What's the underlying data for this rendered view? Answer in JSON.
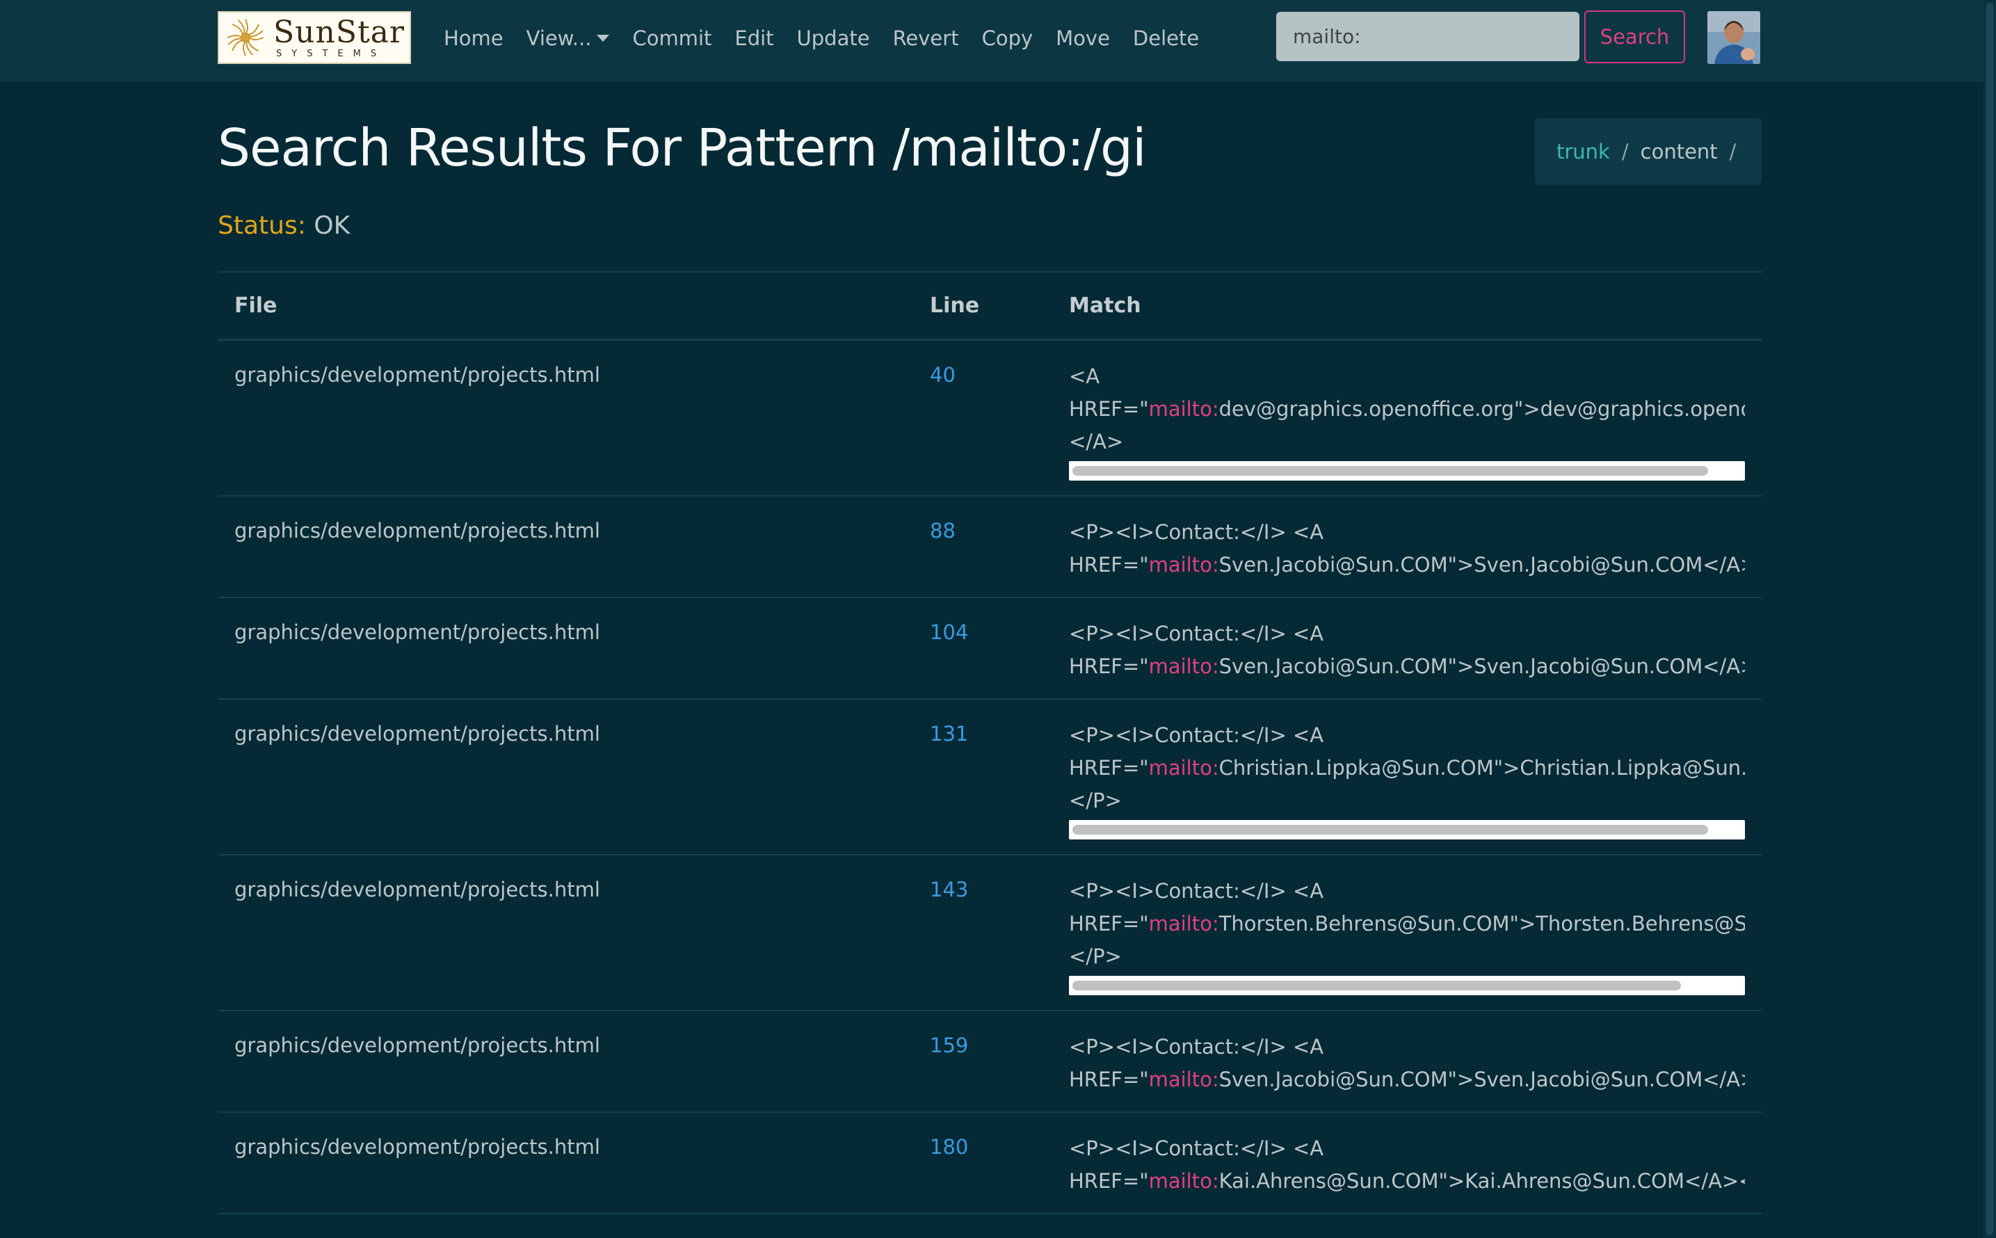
{
  "brand": {
    "name": "SunStar",
    "subtitle": "SYSTEMS"
  },
  "nav": {
    "items": [
      "Home",
      "View...",
      "Commit",
      "Edit",
      "Update",
      "Revert",
      "Copy",
      "Move",
      "Delete"
    ]
  },
  "search": {
    "value": "mailto:",
    "button_label": "Search"
  },
  "page": {
    "title": "Search Results For Pattern /mailto:/gi",
    "status_label": "Status:",
    "status_value": "OK"
  },
  "breadcrumb": {
    "items": [
      "trunk",
      "content"
    ],
    "separator": "/"
  },
  "table": {
    "headers": {
      "file": "File",
      "line": "Line",
      "match": "Match"
    },
    "rows": [
      {
        "file": "graphics/development/projects.html",
        "line": "40",
        "match_lines": [
          {
            "pre": "<A",
            "hl": "",
            "post": ""
          },
          {
            "pre": "HREF=\"",
            "hl": "mailto:",
            "post": "dev@graphics.openoffice.org\">dev@graphics.openoffice.org"
          },
          {
            "pre": "</A>",
            "hl": "",
            "post": ""
          }
        ],
        "scroll_visible_fraction": 0.95
      },
      {
        "file": "graphics/development/projects.html",
        "line": "88",
        "match_lines": [
          {
            "pre": "<P><I>Contact:</I> <A",
            "hl": "",
            "post": ""
          },
          {
            "pre": "HREF=\"",
            "hl": "mailto:",
            "post": "Sven.Jacobi@Sun.COM\">Sven.Jacobi@Sun.COM</A></P>"
          }
        ]
      },
      {
        "file": "graphics/development/projects.html",
        "line": "104",
        "match_lines": [
          {
            "pre": "<P><I>Contact:</I> <A",
            "hl": "",
            "post": ""
          },
          {
            "pre": "HREF=\"",
            "hl": "mailto:",
            "post": "Sven.Jacobi@Sun.COM\">Sven.Jacobi@Sun.COM</A></P>"
          }
        ]
      },
      {
        "file": "graphics/development/projects.html",
        "line": "131",
        "match_lines": [
          {
            "pre": "<P><I>Contact:</I> <A",
            "hl": "",
            "post": ""
          },
          {
            "pre": "HREF=\"",
            "hl": "mailto:",
            "post": "Christian.Lippka@Sun.COM\">Christian.Lippka@Sun.COM</A>"
          },
          {
            "pre": "</P>",
            "hl": "",
            "post": ""
          }
        ],
        "scroll_visible_fraction": 0.95
      },
      {
        "file": "graphics/development/projects.html",
        "line": "143",
        "match_lines": [
          {
            "pre": "<P><I>Contact:</I> <A",
            "hl": "",
            "post": ""
          },
          {
            "pre": "HREF=\"",
            "hl": "mailto:",
            "post": "Thorsten.Behrens@Sun.COM\">Thorsten.Behrens@Sun.COM</A>"
          },
          {
            "pre": "</P>",
            "hl": "",
            "post": ""
          }
        ],
        "scroll_visible_fraction": 0.91
      },
      {
        "file": "graphics/development/projects.html",
        "line": "159",
        "match_lines": [
          {
            "pre": "<P><I>Contact:</I> <A",
            "hl": "",
            "post": ""
          },
          {
            "pre": "HREF=\"",
            "hl": "mailto:",
            "post": "Sven.Jacobi@Sun.COM\">Sven.Jacobi@Sun.COM</A></P>"
          }
        ]
      },
      {
        "file": "graphics/development/projects.html",
        "line": "180",
        "match_lines": [
          {
            "pre": "<P><I>Contact:</I> <A",
            "hl": "",
            "post": ""
          },
          {
            "pre": "HREF=\"",
            "hl": "mailto:",
            "post": "Kai.Ahrens@Sun.COM\">Kai.Ahrens@Sun.COM</A></P>"
          }
        ]
      }
    ]
  },
  "colors": {
    "background": "#062a35",
    "navbar": "#0c3642",
    "accent_pink": "#e0407f",
    "link_blue": "#3a9ae0",
    "breadcrumb_link": "#3fb8b0",
    "status_label": "#e3a51b"
  },
  "icons": {
    "brand": "sunstar-logo",
    "avatar": "user-avatar",
    "dropdown": "caret-down-icon"
  }
}
